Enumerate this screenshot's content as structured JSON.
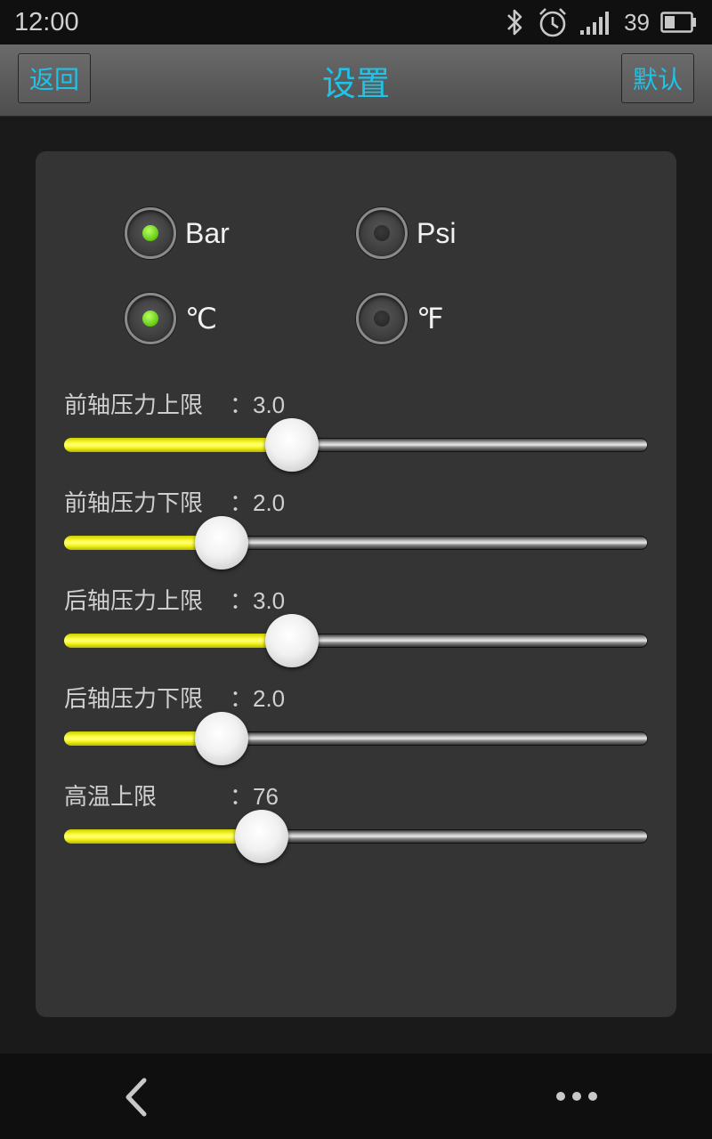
{
  "statusbar": {
    "time": "12:00",
    "battery_percent": "39",
    "icons": [
      "bluetooth-icon",
      "alarm-icon",
      "signal-icon",
      "battery-icon"
    ]
  },
  "titlebar": {
    "back_label": "返回",
    "title": "设置",
    "default_label": "默认"
  },
  "units": {
    "pressure": {
      "options": [
        "Bar",
        "Psi"
      ],
      "selected": "Bar"
    },
    "temperature": {
      "options": [
        "℃",
        "℉"
      ],
      "selected": "℃"
    }
  },
  "settings": [
    {
      "label": "前轴压力上限",
      "value": "：3.0",
      "fraction": 0.39
    },
    {
      "label": "前轴压力下限",
      "value": "：2.0",
      "fraction": 0.27
    },
    {
      "label": "后轴压力上限",
      "value": "：3.0",
      "fraction": 0.39
    },
    {
      "label": "后轴压力下限",
      "value": "：2.0",
      "fraction": 0.27
    },
    {
      "label": "高温上限",
      "value": "：76",
      "fraction": 0.338
    }
  ],
  "colors": {
    "accent": "#1fc3e8",
    "slider_fill": "#f6f61a",
    "radio_on": "#6ed11c"
  }
}
